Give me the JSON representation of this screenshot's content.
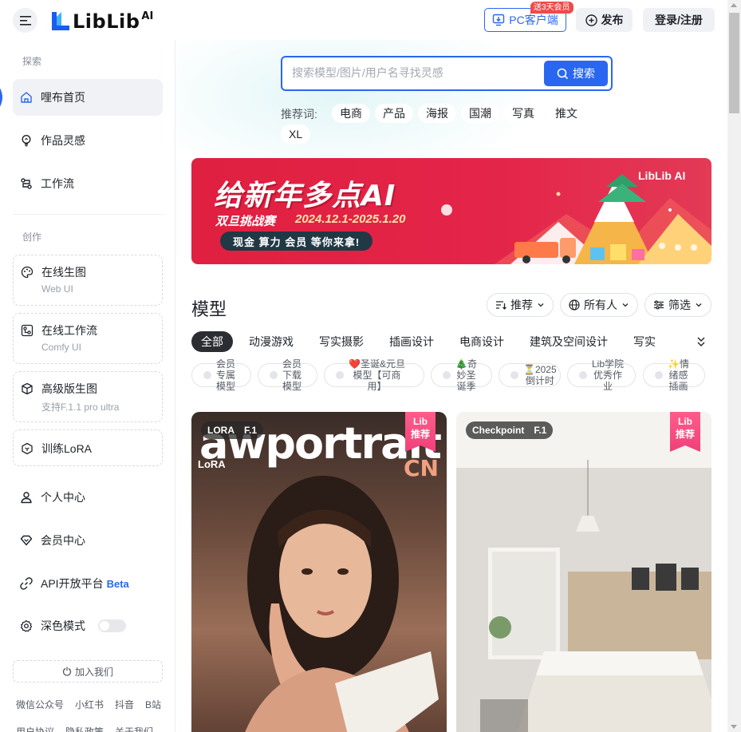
{
  "header": {
    "logo_text": "LibLib",
    "logo_sup": "AI",
    "pc_client_label": "PC客户端",
    "pc_badge": "送3天会员",
    "publish_label": "发布",
    "login_label": "登录/注册"
  },
  "sidebar": {
    "section_explore": "探索",
    "section_create": "创作",
    "explore_items": [
      {
        "label": "哩布首页",
        "icon": "home-icon"
      },
      {
        "label": "作品灵感",
        "icon": "bulb-icon"
      },
      {
        "label": "工作流",
        "icon": "workflow-icon"
      }
    ],
    "create_cards": [
      {
        "label": "在线生图",
        "sub": "Web UI",
        "icon": "palette-icon"
      },
      {
        "label": "在线工作流",
        "sub": "Comfy UI",
        "icon": "nodes-icon"
      },
      {
        "label": "高级版生图",
        "sub": "支持F.1.1 pro ultra",
        "icon": "cube-icon"
      },
      {
        "label": "训练LoRA",
        "sub": "",
        "icon": "hexagon-icon"
      }
    ],
    "personal_items": [
      {
        "label": "个人中心",
        "icon": "user-icon"
      },
      {
        "label": "会员中心",
        "icon": "diamond-icon"
      },
      {
        "label": "API开放平台",
        "icon": "link-icon",
        "suffix": "Beta"
      },
      {
        "label": "深色模式",
        "icon": "settings-icon"
      }
    ],
    "join_label": "加入我们",
    "footer_links": [
      "微信公众号",
      "小红书",
      "抖音",
      "B站"
    ],
    "footer_links2": [
      "用户协议",
      "隐私政策",
      "关于我们"
    ]
  },
  "search": {
    "placeholder": "搜索模型/图片/用户名寻找灵感",
    "button_label": "搜索",
    "tags_label": "推荐词:",
    "tags": [
      "电商",
      "产品",
      "海报",
      "国潮",
      "写真",
      "推文",
      "XL"
    ]
  },
  "banner": {
    "title": "给新年多点AI",
    "subtitle_left": "双旦挑战赛",
    "subtitle_dates": "2024.12.1-2025.1.20",
    "pill_text": "现金 算力 会员 等你来拿!",
    "logo": "LibLib AI"
  },
  "models": {
    "title": "模型",
    "sort_label": "推荐",
    "owner_label": "所有人",
    "filter_label": "筛选",
    "categories": [
      "全部",
      "动漫游戏",
      "写实摄影",
      "插画设计",
      "电商设计",
      "建筑及空间设计",
      "写实"
    ],
    "sub_tags": [
      {
        "text": "会员\n专属\n模型",
        "emoji": ""
      },
      {
        "text": "会员\n下载\n模型",
        "emoji": ""
      },
      {
        "text": "圣诞&元旦\n模型【可商\n用】",
        "emoji": "❤️"
      },
      {
        "text": "奇\n妙圣\n诞季",
        "emoji": "🎄"
      },
      {
        "text": "2025\n倒计时",
        "emoji": "⏳"
      },
      {
        "text": "Lib学院\n优秀作\n业",
        "emoji": ""
      },
      {
        "text": "情\n绪感\n插画",
        "emoji": "✨"
      }
    ],
    "cards": [
      {
        "type": "LORA",
        "base": "F.1",
        "overlay_title": "awportrait",
        "overlay_sub": "LoRA",
        "overlay_cn": "CN",
        "rec_line1": "Lib",
        "rec_line2": "推荐"
      },
      {
        "type": "Checkpoint",
        "base": "F.1",
        "rec_line1": "Lib",
        "rec_line2": "推荐"
      }
    ]
  },
  "colors": {
    "accent": "#2a67f0",
    "banner_red": "#e02040",
    "rec_pink": "#f0407a"
  }
}
